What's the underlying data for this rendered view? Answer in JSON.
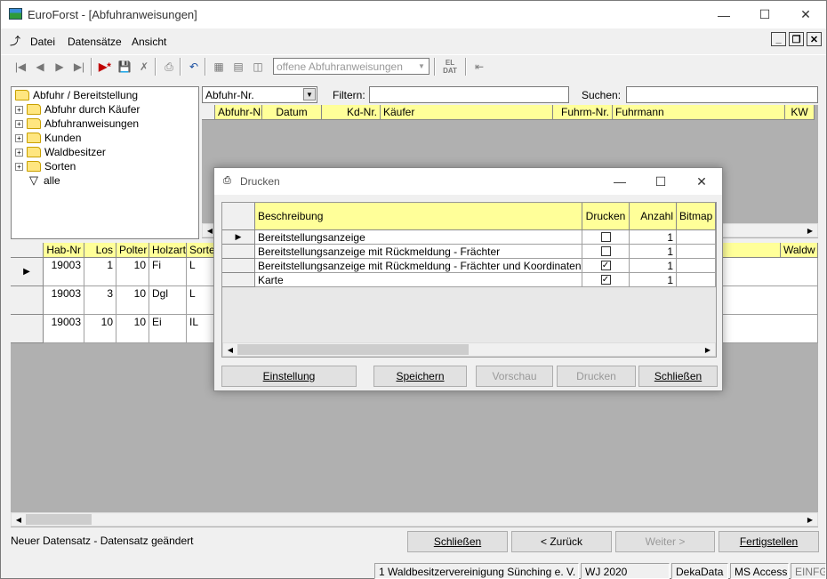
{
  "window": {
    "title": "EuroForst - [Abfuhranweisungen]"
  },
  "menu": [
    "Datei",
    "Datensätze",
    "Ansicht"
  ],
  "toolbar": {
    "view_combo": "offene Abfuhranweisungen",
    "eldat_label": "EL DAT"
  },
  "tree": {
    "root": "Abfuhr / Bereitstellung",
    "items": [
      "Abfuhr durch Käufer",
      "Abfuhranweisungen",
      "Kunden",
      "Waldbesitzer",
      "Sorten"
    ],
    "filter_item": "alle"
  },
  "search": {
    "field_combo": "Abfuhr-Nr.",
    "filter_label": "Filtern:",
    "search_label": "Suchen:"
  },
  "upper_grid": {
    "headers": [
      "Abfuhr-Nr.",
      "Datum",
      "Kd-Nr.",
      "Käufer",
      "Fuhrm-Nr.",
      "Fuhrmann",
      "KW"
    ]
  },
  "lower_grid": {
    "headers": [
      "Hab-Nr",
      "Los",
      "Polter",
      "Holzart",
      "Sorte"
    ],
    "right_header": "Waldw",
    "rows": [
      [
        "19003",
        "1",
        "10",
        "Fi",
        "L"
      ],
      [
        "19003",
        "3",
        "10",
        "Dgl",
        "L"
      ],
      [
        "19003",
        "10",
        "10",
        "Ei",
        "IL"
      ]
    ]
  },
  "buttons": {
    "close": "Schließen",
    "back": "< Zurück",
    "next": "Weiter >",
    "finish": "Fertigstellen"
  },
  "status_message": "Neuer Datensatz - Datensatz geändert",
  "statusbar": [
    "1 Waldbesitzervereinigung Sünching e. V.",
    "WJ 2020",
    "DekaData",
    "MS Access",
    "EINFG"
  ],
  "dialog": {
    "title": "Drucken",
    "headers": [
      "Beschreibung",
      "Drucken",
      "Anzahl",
      "Bitmap"
    ],
    "rows": [
      {
        "desc": "Bereitstellungsanzeige",
        "checked": false,
        "count": "1"
      },
      {
        "desc": "Bereitstellungsanzeige mit Rückmeldung - Frächter",
        "checked": false,
        "count": "1"
      },
      {
        "desc": "Bereitstellungsanzeige mit Rückmeldung - Frächter und Koordinaten",
        "checked": true,
        "count": "1"
      },
      {
        "desc": "Karte",
        "checked": true,
        "count": "1"
      }
    ],
    "buttons": {
      "settings": "Einstellung",
      "save": "Speichern",
      "preview": "Vorschau",
      "print": "Drucken",
      "close": "Schließen"
    }
  },
  "colors": {
    "header_yellow": "#ffff99",
    "grid_bg": "#b0b0b0",
    "accent": "#0078d7"
  }
}
